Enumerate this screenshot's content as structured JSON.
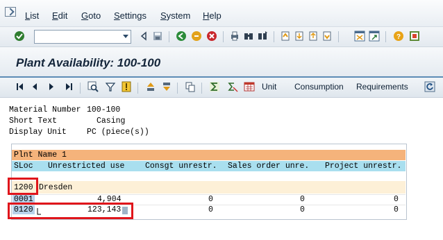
{
  "menu": {
    "items": [
      {
        "label": "List",
        "underline": "L",
        "rest": "ist"
      },
      {
        "label": "Edit",
        "underline": "E",
        "rest": "dit"
      },
      {
        "label": "Goto",
        "underline": "G",
        "rest": "oto"
      },
      {
        "label": "Settings",
        "underline": "S",
        "rest": "ettings"
      },
      {
        "label": "System",
        "underline": "S",
        "rest": "ystem"
      },
      {
        "label": "Help",
        "underline": "H",
        "rest": "elp"
      }
    ]
  },
  "command_field": {
    "value": ""
  },
  "title": "Plant Availability: 100-100",
  "app_toolbar": {
    "unit_label": "Unit",
    "consumption_label": "Consumption",
    "requirements_label": "Requirements"
  },
  "header": {
    "material_number_label": "Material Number",
    "material_number_value": "100-100",
    "short_text_label": "Short Text",
    "short_text_value": "Casing",
    "display_unit_label": "Display Unit",
    "display_unit_value": "PC (piece(s))"
  },
  "list": {
    "plant_header": "Plnt Name 1",
    "columns": [
      "SLoc",
      "Unrestricted use",
      "Consgt unrestr.",
      "Sales order unre.",
      "Project unrestr."
    ],
    "plant_row": {
      "plant": "1200",
      "name": "Dresden"
    },
    "rows": [
      {
        "sloc": "0001",
        "unrestricted": "4,904",
        "consignment": "0",
        "sales_order": "0",
        "project": "0"
      },
      {
        "sloc": "0120",
        "unrestricted": "123,143",
        "consignment": "0",
        "sales_order": "0",
        "project": "0"
      }
    ]
  },
  "colors": {
    "plant_header_bg": "#f5b37b",
    "column_header_bg": "#a9dfef",
    "plant_row_bg": "#fdf0d7",
    "highlight_border": "#e0151b",
    "title_rule": "#5d8cb6"
  }
}
